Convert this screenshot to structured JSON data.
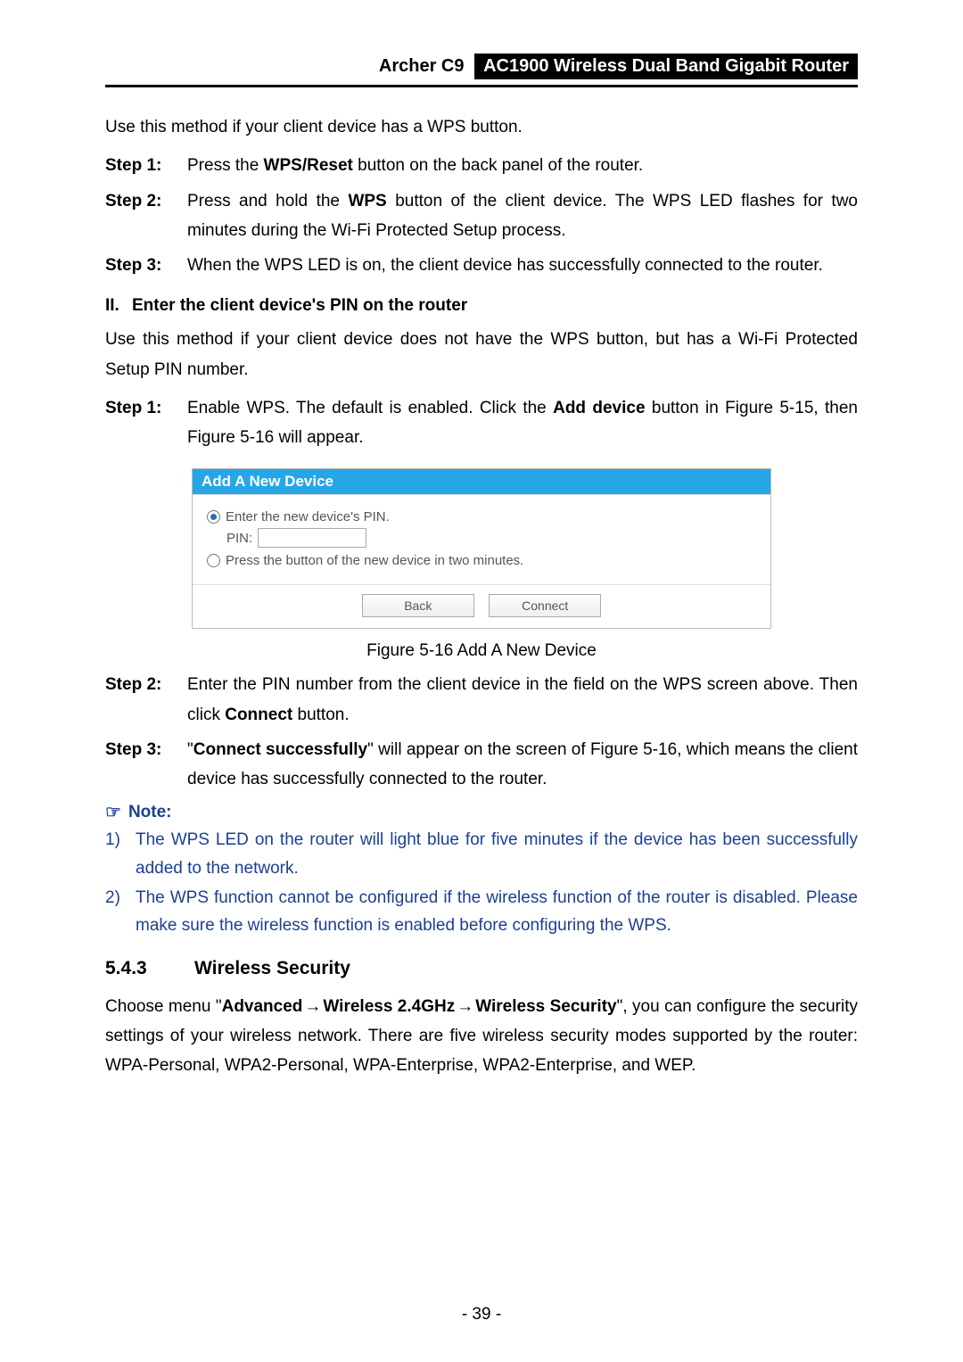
{
  "header": {
    "model": "Archer C9",
    "product": "AC1900 Wireless Dual Band Gigabit Router"
  },
  "intro1": "Use this method if your client device has a WPS button.",
  "steps_a": [
    {
      "label": "Step 1:",
      "pre": "Press the ",
      "bold": "WPS/Reset",
      "post": " button on the back panel of the router."
    },
    {
      "label": "Step 2:",
      "pre": "Press and hold the ",
      "bold": "WPS",
      "post": " button of the client device. The WPS LED flashes for two minutes during the Wi-Fi Protected Setup process."
    },
    {
      "label": "Step 3:",
      "text": "When the WPS LED is on, the client device has successfully connected to the router."
    }
  ],
  "subhead": {
    "num": "II.",
    "text": "Enter the client device's PIN on the router"
  },
  "intro2": "Use this method if your client device does not have the WPS button, but has a Wi-Fi Protected Setup PIN number.",
  "step_b1": {
    "label": "Step 1:",
    "pre": "Enable WPS. The default is enabled. Click the ",
    "bold": "Add device",
    "post": " button in Figure 5-15, then Figure 5-16 will appear."
  },
  "figure": {
    "title": "Add A New Device",
    "opt1": "Enter the new device's PIN.",
    "pin_label": "PIN:",
    "pin_value": "",
    "opt2": "Press the button of the new device in two minutes.",
    "btn_back": "Back",
    "btn_connect": "Connect",
    "caption": "Figure 5-16 Add A New Device"
  },
  "step_b2": {
    "label": "Step 2:",
    "pre": "Enter the PIN number from the client device in the field on the WPS screen above. Then click ",
    "bold": "Connect",
    "post": " button."
  },
  "step_b3": {
    "label": "Step 3:",
    "pre": "\"",
    "bold": "Connect successfully",
    "post": "\" will appear on the screen of Figure 5-16, which means the client device has successfully connected to the router."
  },
  "note_label": "Note:",
  "notes": [
    {
      "num": "1)",
      "text": "The WPS LED on the router will light blue for five minutes if the device has been successfully added to the network."
    },
    {
      "num": "2)",
      "text": "The WPS function cannot be configured if the wireless function of the router is disabled. Please make sure the wireless function is enabled before configuring the WPS."
    }
  ],
  "section": {
    "num": "5.4.3",
    "title": "Wireless Security"
  },
  "section_para": {
    "pre": "Choose menu \"",
    "b1": "Advanced",
    "arrow": "→",
    "b2": "Wireless 2.4GHz",
    "b3": "Wireless Security",
    "post": "\", you can configure the security settings of your wireless network. There are five wireless security modes supported by the router: WPA-Personal, WPA2-Personal, WPA-Enterprise, WPA2-Enterprise, and WEP."
  },
  "page_number": "- 39 -"
}
